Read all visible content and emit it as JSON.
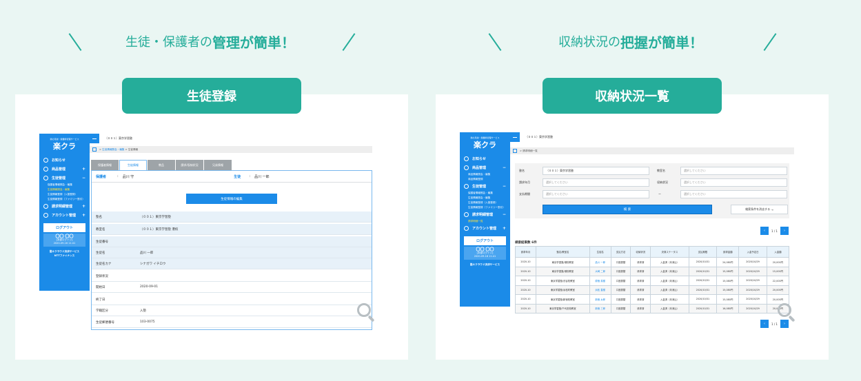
{
  "left": {
    "heading_pre": "生徒・保護者の",
    "heading_strong": "管理が簡単！",
    "pill": "生徒登録"
  },
  "right": {
    "heading_pre": "収納状況の",
    "heading_strong": "把握が簡単！",
    "pill": "収納状況一覧"
  },
  "app": {
    "logo_small": "塾の月謝・授業料管理サービス",
    "logo": "楽クラ",
    "nav": {
      "notice": "お知らせ",
      "product": "商品管理",
      "student": "生徒管理",
      "billing": "請求明細管理",
      "account": "アカウント管理"
    },
    "sub_left": [
      "保護者情報照会・編集",
      "生徒情報照会・編集",
      "生徒情報登録（入塾登録）",
      "生徒情報登録（ファミリー割引）"
    ],
    "sub_product_right": [
      "商品情報照会・編集",
      "商品情報登録"
    ],
    "sub_student_right": [
      "保護者情報照会・編集",
      "生徒情報照会・編集",
      "生徒情報登録（入塾登録）",
      "生徒情報登録（ファミリー割引）"
    ],
    "sub_billing_right": [
      "請求明細一覧"
    ],
    "logout": "ログアウト",
    "user_name": "〇〇 〇〇",
    "user_role": "[本部ログイン]",
    "user_time": "2020-09-16 11:41",
    "footer1": "塾々クラウド決済サービス",
    "footer2": "NTTファイナンス"
  },
  "student_screen": {
    "school": "（００１）東京学習塾",
    "crumb_link": "生徒情報照会・編集",
    "crumb_sep": ">",
    "crumb_current": "生徒情報",
    "tabs": [
      "保護者情報",
      "生徒情報",
      "教品",
      "請求/収納状況",
      "兄弟情報"
    ],
    "guardian_label": "保護者",
    "guardian_value": "品川 守",
    "student_label": "生徒",
    "student_value": "品川 一郎",
    "edit_button": "生徒情報の編集",
    "fields": [
      {
        "k": "塾名",
        "v": "（００１）東京学習塾"
      },
      {
        "k": "教室名",
        "v": "（００１）東京学習塾 港校"
      },
      {
        "k": "生徒番号",
        "v": ""
      },
      {
        "k": "生徒名",
        "v": "品川 一郎"
      },
      {
        "k": "生徒名カナ",
        "v": "シナガワ イチロウ"
      },
      {
        "k": "登録状況",
        "v": ""
      },
      {
        "k": "開始日",
        "v": "2020-09-01"
      },
      {
        "k": "終了日",
        "v": ""
      },
      {
        "k": "学籍区分",
        "v": "入塾"
      },
      {
        "k": "生徒郵便番号",
        "v": "103-0075"
      }
    ]
  },
  "billing_screen": {
    "school": "（００１）東京学習塾",
    "crumb_current": "請求明細一覧",
    "labels": {
      "school": "塾名",
      "classroom": "教室名",
      "month": "請求年月",
      "status": "収納状況",
      "pay_date": "支払期間",
      "dash": "ー"
    },
    "school_value": "（００１）東京学習塾",
    "placeholder": "選択してください",
    "search_button": "検 索",
    "clear_button": "検索条件を消去する",
    "pager": "1 / 1",
    "result_count": "検索結果数 6件",
    "columns": [
      "請求年月",
      "塾名/教室名",
      "生徒名",
      "支払方法",
      "収納状況",
      "決済ステータス",
      "支払期限",
      "請求金額",
      "入金予定日",
      "入金額"
    ],
    "rows": [
      [
        "2020-10",
        "東京学習塾/港校教室",
        "品川 一郎",
        "口座振替",
        "请求済",
        "入金済（未消込）",
        "2020/10/31",
        "24,080円",
        "2020/10/29",
        "20,000円"
      ],
      [
        "2020-10",
        "東京学習塾/港校教室",
        "大崎 二郎",
        "口座振替",
        "请求済",
        "入金済（未消込）",
        "2020/10/31",
        "15,080円",
        "2020/10/29",
        "15,000円"
      ],
      [
        "2020-10",
        "東京学習塾/渋谷校教室",
        "原宿 英樹",
        "口座振替",
        "请求済",
        "入金済（未消込）",
        "2020/10/31",
        "15,080円",
        "2020/10/29",
        "22,000円"
      ],
      [
        "2020-10",
        "東京学習塾/浜松町教室",
        "浜松 直樹",
        "口座振替",
        "请求済",
        "入金済（未消込）",
        "2020/10/31",
        "15,080円",
        "2020/10/29",
        "20,000円"
      ],
      [
        "2020-10",
        "東京学習塾/新宿校教室",
        "新宿 太郎",
        "口座振替",
        "请求済",
        "入金済（未消込）",
        "2020/10/31",
        "15,080円",
        "2020/10/29",
        "20,000円"
      ],
      [
        "2020-10",
        "東京学習塾/千代田校教室",
        "新宿 三郎",
        "口座振替",
        "请求済",
        "入金済（未消込）",
        "2020/10/31",
        "16,080円",
        "2020/10/29",
        "20,000円"
      ]
    ]
  },
  "colors": {
    "teal": "#25ad9a",
    "blue": "#1b8be8",
    "background": "#eaf6f3"
  }
}
